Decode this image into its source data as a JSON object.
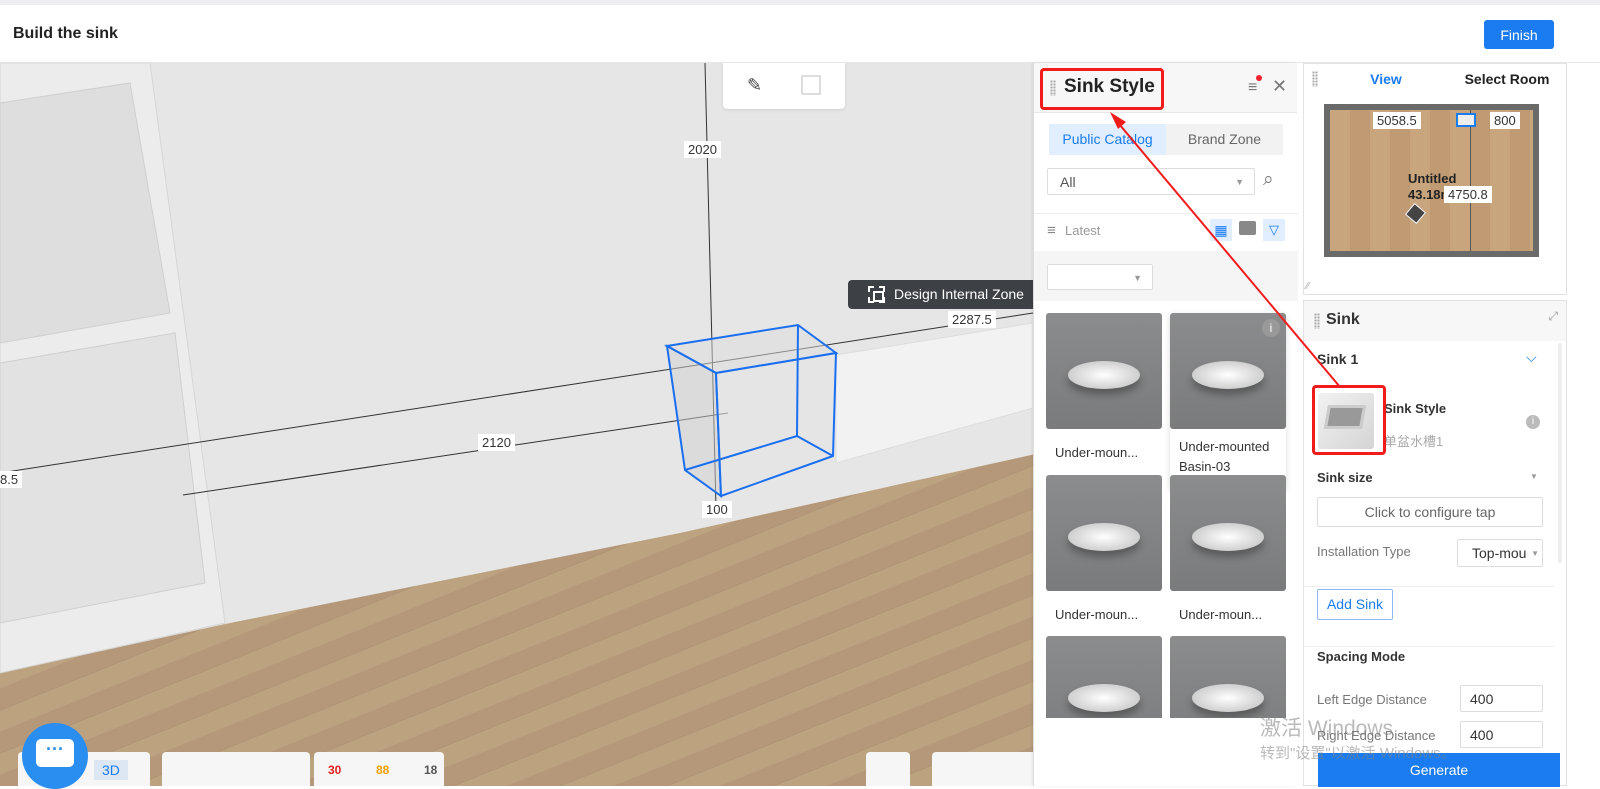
{
  "header": {
    "title": "Build the sink",
    "finish_label": "Finish"
  },
  "viewport": {
    "dimensions": {
      "height": "2020",
      "top_length": "2287.5",
      "wall_length": "2120",
      "left_cut": "8.5",
      "bottom": "100"
    },
    "design_internal_zone_label": "Design Internal Zone",
    "bottom_toolbar": {
      "view_mode": "3D",
      "error_count": "30",
      "warning_count": "88",
      "info_count": "18"
    }
  },
  "catalog": {
    "title": "Sink Style",
    "tabs": [
      {
        "label": "Public Catalog",
        "active": true
      },
      {
        "label": "Brand Zone",
        "active": false
      }
    ],
    "category_select": "All",
    "sort_label": "Latest",
    "filter_select": "",
    "items": [
      {
        "name": "Under-moun..."
      },
      {
        "name": "Under-mounted Basin-03"
      },
      {
        "name": "Under-moun..."
      },
      {
        "name": "Under-moun..."
      },
      {
        "name": ""
      },
      {
        "name": ""
      }
    ]
  },
  "minimap": {
    "tabs": [
      {
        "label": "View",
        "active": true
      },
      {
        "label": "Select Room",
        "active": false
      }
    ],
    "dim_top": "5058.5",
    "dim_right_top": "800",
    "room_name": "Untitled",
    "room_area": "43.18m",
    "dim_side": "4750.8"
  },
  "sink_panel": {
    "title": "Sink",
    "section": "Sink 1",
    "style_label": "Sink Style",
    "style_value": "单盆水槽1",
    "size_label": "Sink size",
    "configure_tap_label": "Click to configure tap",
    "installation_type_label": "Installation Type",
    "installation_type_value": "Top-mou",
    "add_sink_label": "Add Sink",
    "spacing_mode_label": "Spacing Mode",
    "left_edge_label": "Left Edge Distance",
    "left_edge_value": "400",
    "right_edge_label": "Right Edge Distance",
    "right_edge_value": "400",
    "generate_label": "Generate"
  },
  "watermark": {
    "line1": "激活 Windows",
    "line2": "转到\"设置\"以激活 Windows。"
  },
  "colors": {
    "accent": "#1a7cf0",
    "annotation": "#f01c1c",
    "selection": "#1a6ff0"
  }
}
